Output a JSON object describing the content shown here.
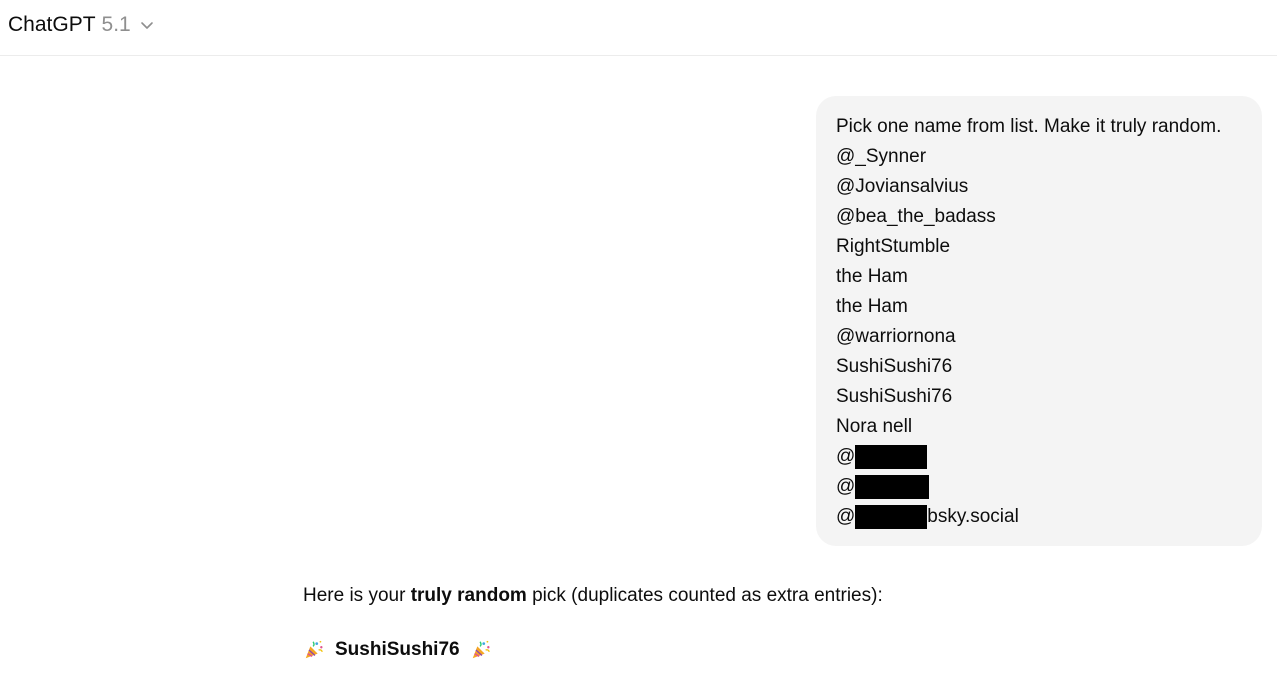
{
  "header": {
    "model_name": "ChatGPT",
    "model_version": "5.1",
    "chevron_icon": "chevron-down-icon"
  },
  "user_message": {
    "lines": [
      {
        "text": "Pick one name from list. Make it truly random."
      },
      {
        "text": "@_Synner"
      },
      {
        "text": "@Joviansalvius"
      },
      {
        "text": "@bea_the_badass"
      },
      {
        "text": "RightStumble"
      },
      {
        "text": "the Ham"
      },
      {
        "text": "the Ham"
      },
      {
        "text": "@warriornona"
      },
      {
        "text": "SushiSushi76"
      },
      {
        "text": "SushiSushi76"
      },
      {
        "text": "Nora nell"
      }
    ],
    "redacted_lines": [
      {
        "prefix": "@",
        "suffix": ""
      },
      {
        "prefix": "@",
        "suffix": ""
      },
      {
        "prefix": "@",
        "suffix": "bsky.social"
      }
    ]
  },
  "assistant_message": {
    "intro_before": "Here is your ",
    "intro_bold": "truly random",
    "intro_after": " pick (duplicates counted as extra entries):",
    "pick": "SushiSushi76",
    "icon": "party-popper-icon"
  }
}
